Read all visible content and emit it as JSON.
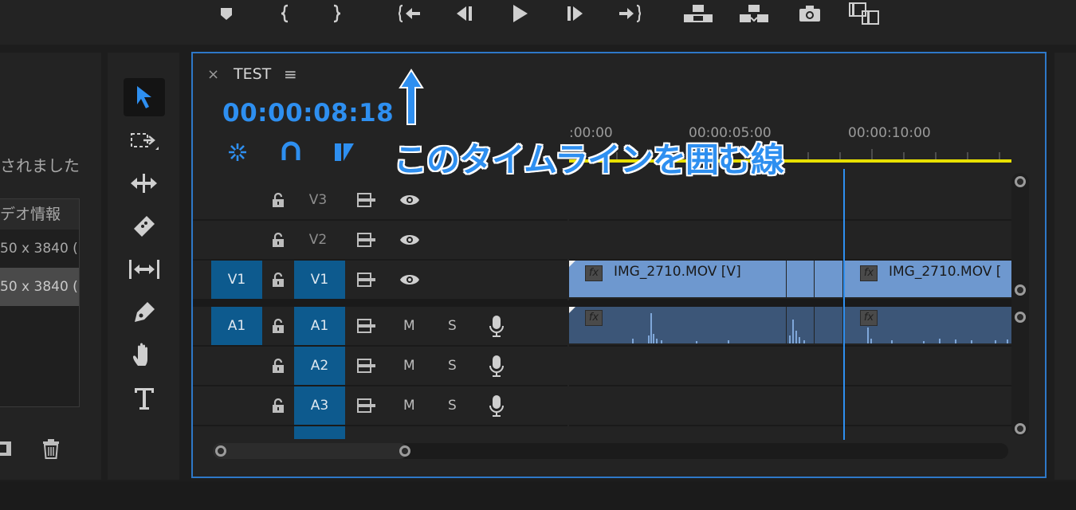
{
  "transport": {
    "buttons": [
      "marker-icon",
      "mark-in-icon",
      "mark-out-icon",
      "go-to-in-icon",
      "step-back-icon",
      "play-icon",
      "step-forward-icon",
      "go-to-out-icon",
      "lift-icon",
      "extract-icon",
      "export-frame-icon",
      "compare-icon"
    ]
  },
  "project": {
    "status_text": "されました",
    "column_header": "デオ情報",
    "rows": [
      "50 x 3840 (1",
      "50 x 3840 (1"
    ]
  },
  "tools": [
    "selection-tool",
    "track-select-tool",
    "ripple-edit-tool",
    "razor-tool",
    "slip-tool",
    "pen-tool",
    "hand-tool",
    "type-tool"
  ],
  "timeline": {
    "sequence_name": "TEST",
    "close_glyph": "×",
    "menu_glyph": "≡",
    "timecode": "00:00:08:18",
    "ruler_labels": [
      ":00:00",
      "00:00:05:00",
      "00:00:10:00"
    ],
    "tracks": [
      {
        "src": "",
        "name": "V3",
        "type": "video"
      },
      {
        "src": "",
        "name": "V2",
        "type": "video"
      },
      {
        "src": "V1",
        "name": "V1",
        "type": "video"
      },
      {
        "src": "A1",
        "name": "A1",
        "type": "audio"
      },
      {
        "src": "",
        "name": "A2",
        "type": "audio"
      },
      {
        "src": "",
        "name": "A3",
        "type": "audio"
      }
    ],
    "mute_label": "M",
    "solo_label": "S",
    "clips": {
      "video": [
        {
          "name": "IMG_2710.MOV [V]"
        },
        {
          "name": "IMG_2710.MOV ["
        }
      ],
      "fx_label": "fx"
    }
  },
  "annotation": {
    "text": "このタイムラインを囲む線",
    "color": "#2e8ff0"
  },
  "colors": {
    "accent_blue": "#2e8ff0",
    "track_target": "#0d5a8e",
    "video_clip": "#6e98cf",
    "audio_clip": "#3c5678",
    "work_area": "#e8e000"
  }
}
